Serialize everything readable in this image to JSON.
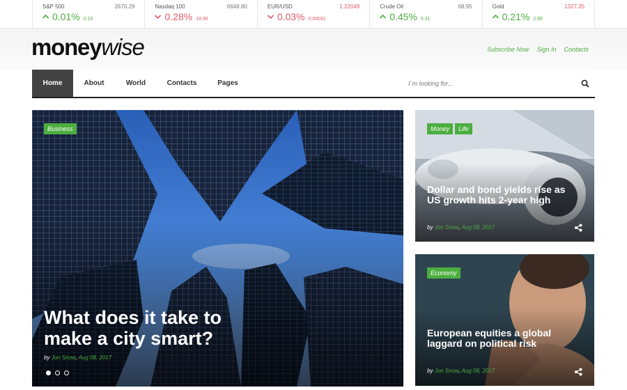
{
  "ticker": [
    {
      "name": "S&P 500",
      "price": "2670.29",
      "pct": "0.01%",
      "change": "0.15",
      "direction": "up",
      "price_color": "#777777"
    },
    {
      "name": "Nasdaq 100",
      "price": "6648.80",
      "pct": "0.28%",
      "change": "18.95",
      "direction": "down",
      "price_color": "#777777"
    },
    {
      "name": "EUR/USD",
      "price": "1.22049",
      "pct": "0.03%",
      "change": "0.00031",
      "direction": "down",
      "price_color": "#e05a6a"
    },
    {
      "name": "Crude Oil",
      "price": "68.95",
      "pct": "0.45%",
      "change": "0.31",
      "direction": "up",
      "price_color": "#777777"
    },
    {
      "name": "Gold",
      "price": "1327.35",
      "pct": "0.21%",
      "change": "2.85",
      "direction": "up",
      "price_color": "#e05a6a"
    }
  ],
  "header": {
    "logo_bold": "money",
    "logo_italic": "wise",
    "links": [
      "Subscribe Now",
      "Sign In",
      "Contacts"
    ]
  },
  "nav": {
    "items": [
      "Home",
      "About",
      "World",
      "Contacts",
      "Pages"
    ],
    "active": "Home",
    "search_placeholder": "I`m looking for..."
  },
  "featured": {
    "tag": "Business",
    "title": "What does it take to make a city smart?",
    "by": "by",
    "author": "Jon Snow",
    "date": "Aug 08, 2017"
  },
  "side_posts": [
    {
      "tags": [
        "Money",
        "Life"
      ],
      "title": "Dollar and bond yields rise as US growth hits 2-year high",
      "by": "by",
      "author": "Jon Snow",
      "date": "Aug 08, 2017"
    },
    {
      "tags": [
        "Economy"
      ],
      "title": "European equities a global laggard on political risk",
      "by": "by",
      "author": "Jon Snow",
      "date": "Aug 08, 2017"
    }
  ],
  "slider": {
    "total": 3,
    "active": 1
  },
  "colors": {
    "accent": "#4cae3f",
    "down": "#e05a6a",
    "nav_active": "#424242"
  },
  "icons": {
    "up": "caret-up-icon",
    "down": "caret-down-icon",
    "search": "search-icon",
    "share": "share-icon"
  }
}
